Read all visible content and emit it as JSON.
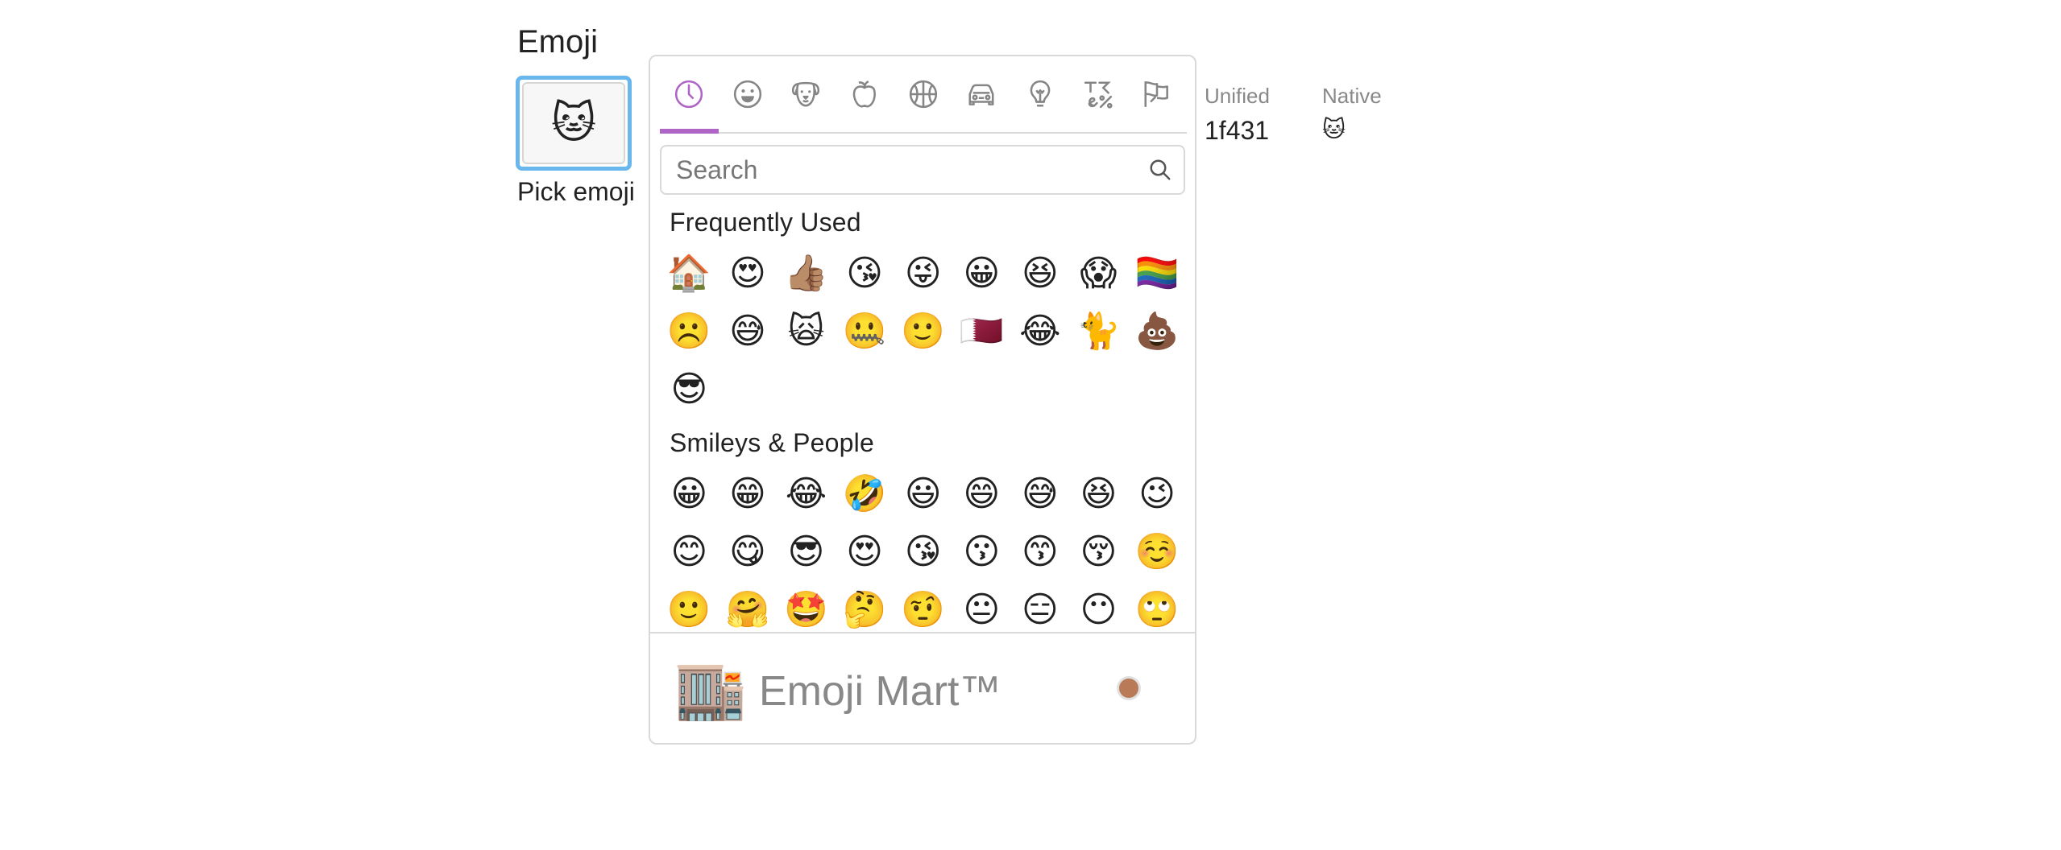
{
  "field": {
    "title": "Emoji",
    "selected_emoji": "🐱",
    "pick_caption": "Pick emoji"
  },
  "picker": {
    "categories": [
      {
        "icon": "clock-icon",
        "active": true
      },
      {
        "icon": "smiley-icon",
        "active": false
      },
      {
        "icon": "dog-icon",
        "active": false
      },
      {
        "icon": "apple-icon",
        "active": false
      },
      {
        "icon": "basketball-icon",
        "active": false
      },
      {
        "icon": "car-icon",
        "active": false
      },
      {
        "icon": "lightbulb-icon",
        "active": false
      },
      {
        "icon": "symbols-icon",
        "active": false
      },
      {
        "icon": "flags-icon",
        "active": false
      }
    ],
    "accent_color": "#ae65c5",
    "search": {
      "placeholder": "Search",
      "value": ""
    },
    "sections": [
      {
        "title": "Frequently Used",
        "emojis": [
          "🏠",
          "😍",
          "👍🏽",
          "😘",
          "😜",
          "😀",
          "😆",
          "😱",
          "🏳️‍🌈",
          "☹️",
          "😅",
          "🙀",
          "🤐",
          "🙂",
          "🇶🇦",
          "😂",
          "🐈",
          "💩",
          "😎"
        ]
      },
      {
        "title": "Smileys & People",
        "emojis": [
          "😀",
          "😁",
          "😂",
          "🤣",
          "😃",
          "😄",
          "😅",
          "😆",
          "😉",
          "😊",
          "😋",
          "😎",
          "😍",
          "😘",
          "😗",
          "😙",
          "😚",
          "☺️",
          "🙂",
          "🤗",
          "🤩",
          "🤔",
          "🤨",
          "😐",
          "😑",
          "😶",
          "🙄"
        ]
      }
    ],
    "preview": {
      "emoji": "🏬",
      "title": "Emoji Mart™",
      "skin_tone_color": "#b97b57"
    }
  },
  "info": {
    "unified_label": "Unified",
    "unified_value": "1f431",
    "native_label": "Native",
    "native_value": "🐱"
  }
}
